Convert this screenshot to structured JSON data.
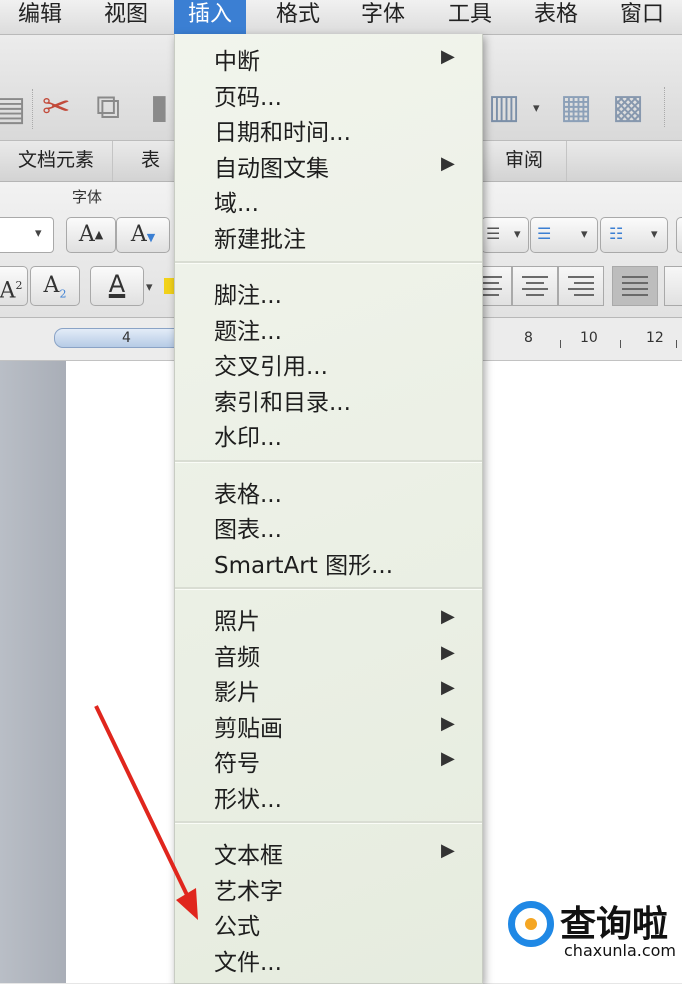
{
  "menubar": {
    "items": [
      "编辑",
      "视图",
      "插入",
      "格式",
      "字体",
      "工具",
      "表格",
      "窗口"
    ],
    "active": "插入"
  },
  "ribbon": {
    "tabs": [
      "文档元素",
      "表格",
      "审阅"
    ],
    "group_label": "字体"
  },
  "ruler": {
    "numbers": [
      "4",
      "8",
      "10",
      "12"
    ]
  },
  "insert_menu": {
    "sections": [
      [
        {
          "label": "中断",
          "submenu": true
        },
        {
          "label": "页码...",
          "submenu": false
        },
        {
          "label": "日期和时间...",
          "submenu": false
        },
        {
          "label": "自动图文集",
          "submenu": true
        },
        {
          "label": "域...",
          "submenu": false
        },
        {
          "label": "新建批注",
          "submenu": false
        }
      ],
      [
        {
          "label": "脚注...",
          "submenu": false
        },
        {
          "label": "题注...",
          "submenu": false
        },
        {
          "label": "交叉引用...",
          "submenu": false
        },
        {
          "label": "索引和目录...",
          "submenu": false
        },
        {
          "label": "水印...",
          "submenu": false
        }
      ],
      [
        {
          "label": "表格...",
          "submenu": false
        },
        {
          "label": "图表...",
          "submenu": false
        },
        {
          "label": "SmartArt 图形...",
          "submenu": false
        }
      ],
      [
        {
          "label": "照片",
          "submenu": true
        },
        {
          "label": "音频",
          "submenu": true
        },
        {
          "label": "影片",
          "submenu": true
        },
        {
          "label": "剪贴画",
          "submenu": true
        },
        {
          "label": "符号",
          "submenu": true
        },
        {
          "label": "形状...",
          "submenu": false
        }
      ],
      [
        {
          "label": "文本框",
          "submenu": true
        },
        {
          "label": "艺术字",
          "submenu": false
        },
        {
          "label": "公式",
          "submenu": false
        },
        {
          "label": "文件...",
          "submenu": false
        }
      ]
    ],
    "submenu_glyph": "▶"
  },
  "toolbar_buttons": {
    "font_size_increase": "A",
    "font_size_decrease": "A",
    "superscript": "A",
    "superscript_mark": "2",
    "subscript": "A",
    "subscript_mark": "2",
    "font_color": "A"
  },
  "watermark": {
    "title": "查询啦",
    "url": "chaxunla.com"
  },
  "colors": {
    "menu_highlight": "#3b7fd3",
    "annotation_arrow": "#e0261d",
    "watermark_blue": "#1f88e5",
    "watermark_orange": "#f5a623"
  }
}
